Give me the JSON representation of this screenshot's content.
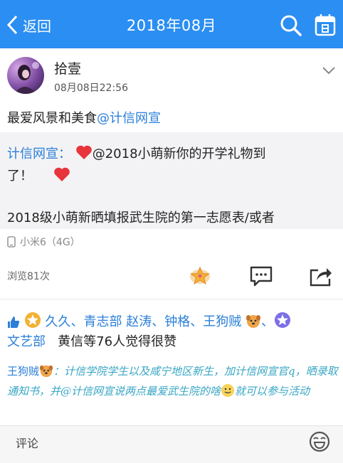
{
  "header": {
    "back_label": "返回",
    "title": "2018年08月",
    "bg_color": "#2b8ef2"
  },
  "post": {
    "author": "拾壹",
    "time": "08月08日22:56",
    "text_prefix": "最爱风景和美食",
    "text_mention": "@计信网宣",
    "quote": {
      "author": "计信网宣：",
      "line1_rest": "@2018小萌新你的开学礼物到",
      "line2": "了！",
      "line3": "2018级小萌新晒填报武生院的第一志愿表/或者"
    },
    "device": "小米6（4G）",
    "views": "浏览81次"
  },
  "likes": {
    "names_line1": "久久、青志部 赵涛、钟格、王狗贼",
    "names_line2": "文艺部",
    "suffix": "黄信等76人觉得很赞"
  },
  "comments": [
    {
      "author": "王狗贼",
      "text_part1": "：计信学院学生以及咸宁地区新生，加计信网宣官q，晒录取通知书，并@计信网宣说两点最爱武生院的啥",
      "text_part2": "就可以参与活动"
    }
  ],
  "comment_input": {
    "placeholder": "评论"
  },
  "icons": {
    "back": "chevron-left-icon",
    "search": "search-icon",
    "calendar": "calendar-icon",
    "more": "chevron-down-icon",
    "device": "phone-icon",
    "star": "star-sticker-icon",
    "comment": "comment-icon",
    "share": "share-icon",
    "thumb": "thumbs-up-icon",
    "emoji": "emoji-icon"
  },
  "colors": {
    "link": "#2b7fd8",
    "heart": "#e8343b",
    "comment_text": "#37a6c4"
  }
}
